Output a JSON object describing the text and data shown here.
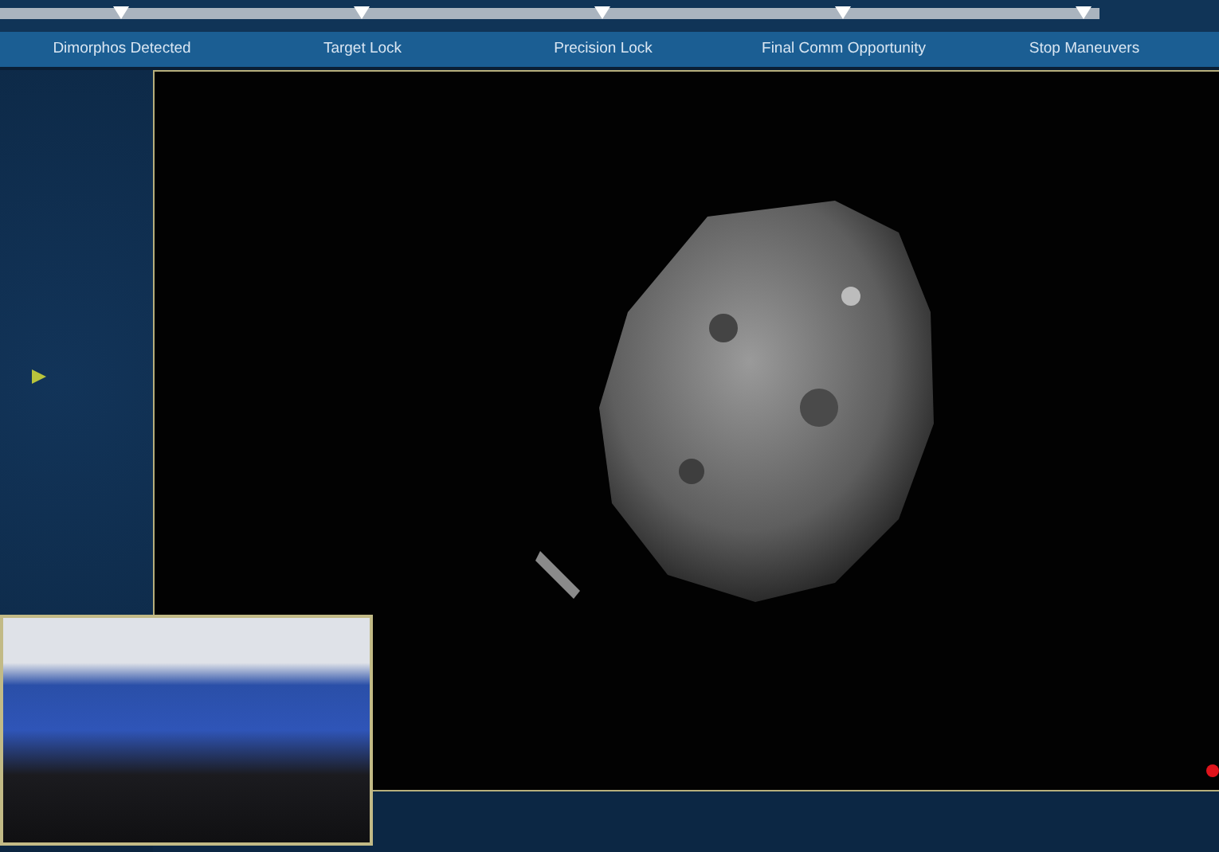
{
  "timeline": {
    "milestones": [
      {
        "label": "Dimorphos Detected"
      },
      {
        "label": "Target Lock"
      },
      {
        "label": "Precision Lock"
      },
      {
        "label": "Final Comm Opportunity"
      },
      {
        "label": "Stop Maneuvers"
      }
    ]
  }
}
